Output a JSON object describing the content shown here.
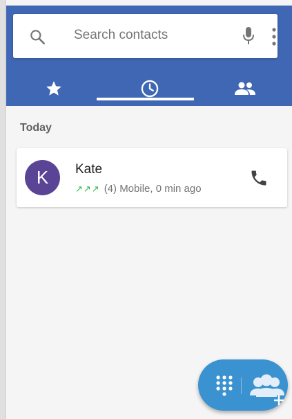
{
  "search": {
    "placeholder": "Search contacts",
    "icon": "search-icon",
    "mic_icon": "microphone-icon",
    "menu_icon": "more-vertical-icon"
  },
  "tabs": [
    {
      "name": "favorites",
      "icon": "star-icon"
    },
    {
      "name": "recents",
      "icon": "clock-icon",
      "selected": true
    },
    {
      "name": "contacts",
      "icon": "people-icon"
    }
  ],
  "colors": {
    "header": "#3f67b3",
    "avatar": "#5a4496",
    "outgoing_arrows": "#2db84b",
    "fab": "#3a92d1"
  },
  "recents": {
    "section_label": "Today",
    "items": [
      {
        "avatar_letter": "K",
        "name": "Kate",
        "arrows": "↗↗↗",
        "detail": "(4) Mobile, 0 min ago",
        "call_icon": "phone-icon"
      }
    ]
  },
  "fab": {
    "dialpad_icon": "dialpad-icon",
    "group_icon": "add-group-icon"
  }
}
